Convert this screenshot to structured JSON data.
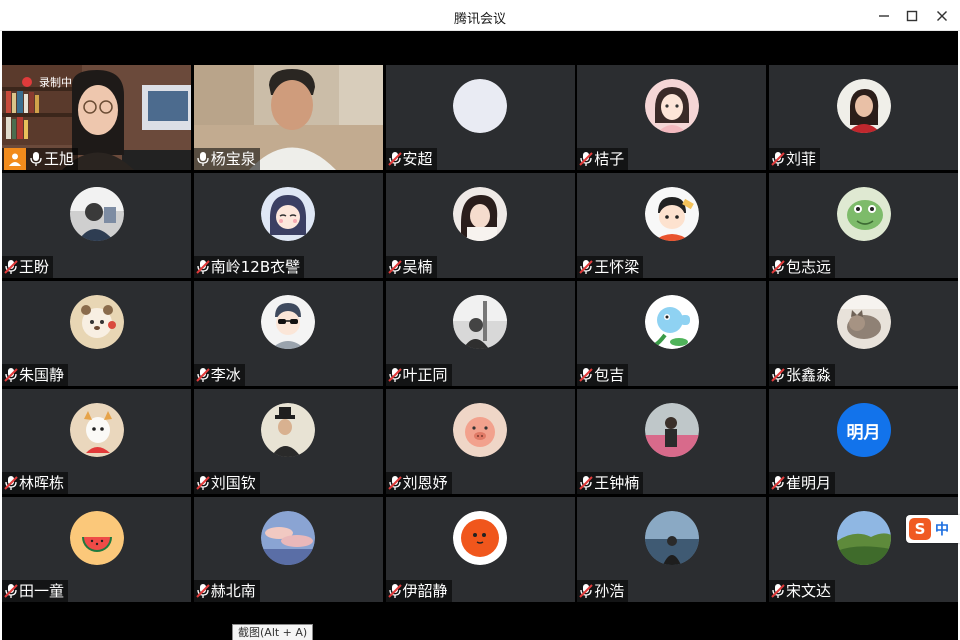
{
  "window": {
    "title": "腾讯会议",
    "controls": [
      "minimize-icon",
      "maximize-icon",
      "close-icon"
    ]
  },
  "recording": {
    "label": "录制中"
  },
  "participants": [
    {
      "name": "王旭",
      "mic": "on",
      "host": true,
      "kind": "video"
    },
    {
      "name": "杨宝泉",
      "mic": "on",
      "kind": "video",
      "active_speaker": true
    },
    {
      "name": "安超",
      "mic": "muted",
      "avatar": "blank"
    },
    {
      "name": "桔子",
      "mic": "muted",
      "avatar": "illustrated-girl"
    },
    {
      "name": "刘菲",
      "mic": "muted",
      "avatar": "portrait-photo"
    },
    {
      "name": "王盼",
      "mic": "muted",
      "avatar": "photo"
    },
    {
      "name": "南岭12B衣譬",
      "mic": "muted",
      "avatar": "anime-girl"
    },
    {
      "name": "吴楠",
      "mic": "muted",
      "avatar": "selfie-photo"
    },
    {
      "name": "王怀梁",
      "mic": "muted",
      "avatar": "cartoon-boy"
    },
    {
      "name": "包志远",
      "mic": "muted",
      "avatar": "green-creature"
    },
    {
      "name": "朱国静",
      "mic": "muted",
      "avatar": "cartoon-bear"
    },
    {
      "name": "李冰",
      "mic": "muted",
      "avatar": "sunglasses-cartoon"
    },
    {
      "name": "叶正同",
      "mic": "muted",
      "avatar": "grayscale-photo"
    },
    {
      "name": "包吉",
      "mic": "muted",
      "avatar": "peashooter"
    },
    {
      "name": "张鑫淼",
      "mic": "muted",
      "avatar": "cat-photo"
    },
    {
      "name": "林晖栋",
      "mic": "muted",
      "avatar": "dog-cartoon"
    },
    {
      "name": "刘国钦",
      "mic": "muted",
      "avatar": "hat-figure"
    },
    {
      "name": "刘恩妤",
      "mic": "muted",
      "avatar": "pig-toy"
    },
    {
      "name": "王钟楠",
      "mic": "muted",
      "avatar": "person-photo"
    },
    {
      "name": "崔明月",
      "mic": "muted",
      "avatar": "text",
      "avatar_text": "明月",
      "avatar_color": "#1273eb"
    },
    {
      "name": "田一童",
      "mic": "muted",
      "avatar": "watermelon"
    },
    {
      "name": "赫北南",
      "mic": "muted",
      "avatar": "cloud-sky"
    },
    {
      "name": "伊韶静",
      "mic": "muted",
      "avatar": "orange-face"
    },
    {
      "name": "孙浩",
      "mic": "muted",
      "avatar": "sea-view"
    },
    {
      "name": "宋文达",
      "mic": "muted",
      "avatar": "hill-landscape"
    }
  ],
  "ime": {
    "logo": "S",
    "lang": "中"
  },
  "tooltip": "截图(Alt + A)",
  "colors": {
    "tile_bg": "#2b2d30",
    "stage_bg": "#000000",
    "active_border": "#3ec46d",
    "muted_mic": "#e03b3b",
    "host_badge": "#f28b1c"
  }
}
